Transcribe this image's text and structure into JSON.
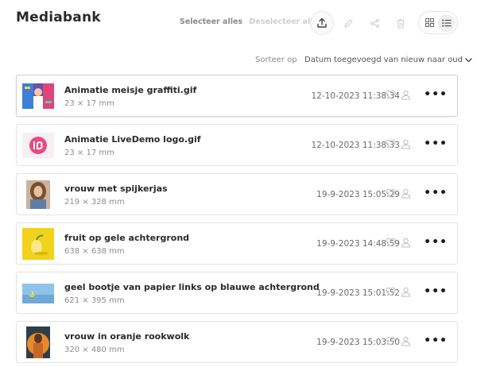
{
  "header": {
    "title": "Mediabank",
    "select_all": "Selecteer alles",
    "deselect_all": "Deselecteer alles",
    "toolbar_icons": [
      "upload-icon",
      "pencil-icon",
      "share-icon",
      "trash-icon"
    ],
    "view_modes": [
      "grid-view-icon",
      "list-view-icon"
    ],
    "active_view": "list"
  },
  "sort": {
    "label": "Sorteer op",
    "value": "Datum toegevoegd van nieuw naar oud"
  },
  "items": [
    {
      "name": "Animatie meisje graffiti.gif",
      "dims": "23 × 17 mm",
      "date": "12-10-2023 11:38:34"
    },
    {
      "name": "Animatie LiveDemo logo.gif",
      "dims": "23 × 17 mm",
      "date": "12-10-2023 11:38:33"
    },
    {
      "name": "vrouw met spijkerjas",
      "dims": "219 × 328 mm",
      "date": "19-9-2023 15:05:29"
    },
    {
      "name": "fruit op gele achtergrond",
      "dims": "638 × 638 mm",
      "date": "19-9-2023 14:48:59"
    },
    {
      "name": "geel bootje van papier links op blauwe achtergrond",
      "dims": "621 × 395 mm",
      "date": "19-9-2023 15:01:52"
    },
    {
      "name": "vrouw in oranje rookwolk",
      "dims": "320 × 480 mm",
      "date": "19-9-2023 15:03:50"
    }
  ],
  "colors": {
    "title": "#2a2a2a",
    "muted": "#8d8d8d",
    "border": "#e2e2e2",
    "logo_pink": "#e94a7f",
    "yellow": "#f2d21a",
    "sky": "#8fc3e8"
  }
}
